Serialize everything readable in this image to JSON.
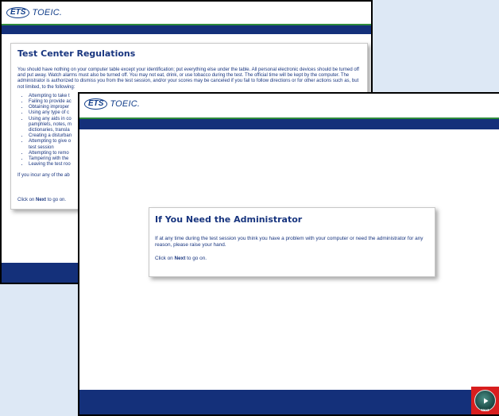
{
  "brand": {
    "ets": "ETS",
    "toeic": "TOEIC."
  },
  "back_screen": {
    "title": "Test Center Regulations",
    "intro": "You should have nothing on your computer table except your identification; put everything else under the table. All personal electronic devices should be turned off and put away. Watch alarms must also be turned off. You may not eat, drink, or use tobacco during the test. The official time will be kept by the computer. The administrator is authorized to dismiss you from the test session, and/or your scores may be canceled if you fail to follow directions or for other actions such as, but not limited, to the following:",
    "bullets": [
      "Attempting to take t",
      "Failing to provide ac",
      "Obtaining improper",
      "Using any type of c",
      "Using any aids in co",
      "pamphlets, notes, m",
      "dictionaries, transla",
      "Creating a disturban",
      "Attempting to give o",
      "test session",
      "Attempting to remo",
      "Tampering with the",
      "Leaving the test roo"
    ],
    "after": "If you incur any of the ab",
    "click_prefix": "Click on ",
    "click_key": "Next",
    "click_suffix": " to go on."
  },
  "front_screen": {
    "title": "If You Need the Administrator",
    "body": "If at any time during the test session you think you have a problem with your computer or need the administrator for any reason, please raise your hand.",
    "click_prefix": "Click on ",
    "click_key": "Next",
    "click_suffix": " to go on."
  },
  "next_button": {
    "label": "Next",
    "icon": "play-arrow-icon",
    "highlight_color": "#d81e1e"
  },
  "colors": {
    "brand_blue": "#14307a",
    "text_blue": "#18357f",
    "accent_green": "#2e8b3c"
  }
}
